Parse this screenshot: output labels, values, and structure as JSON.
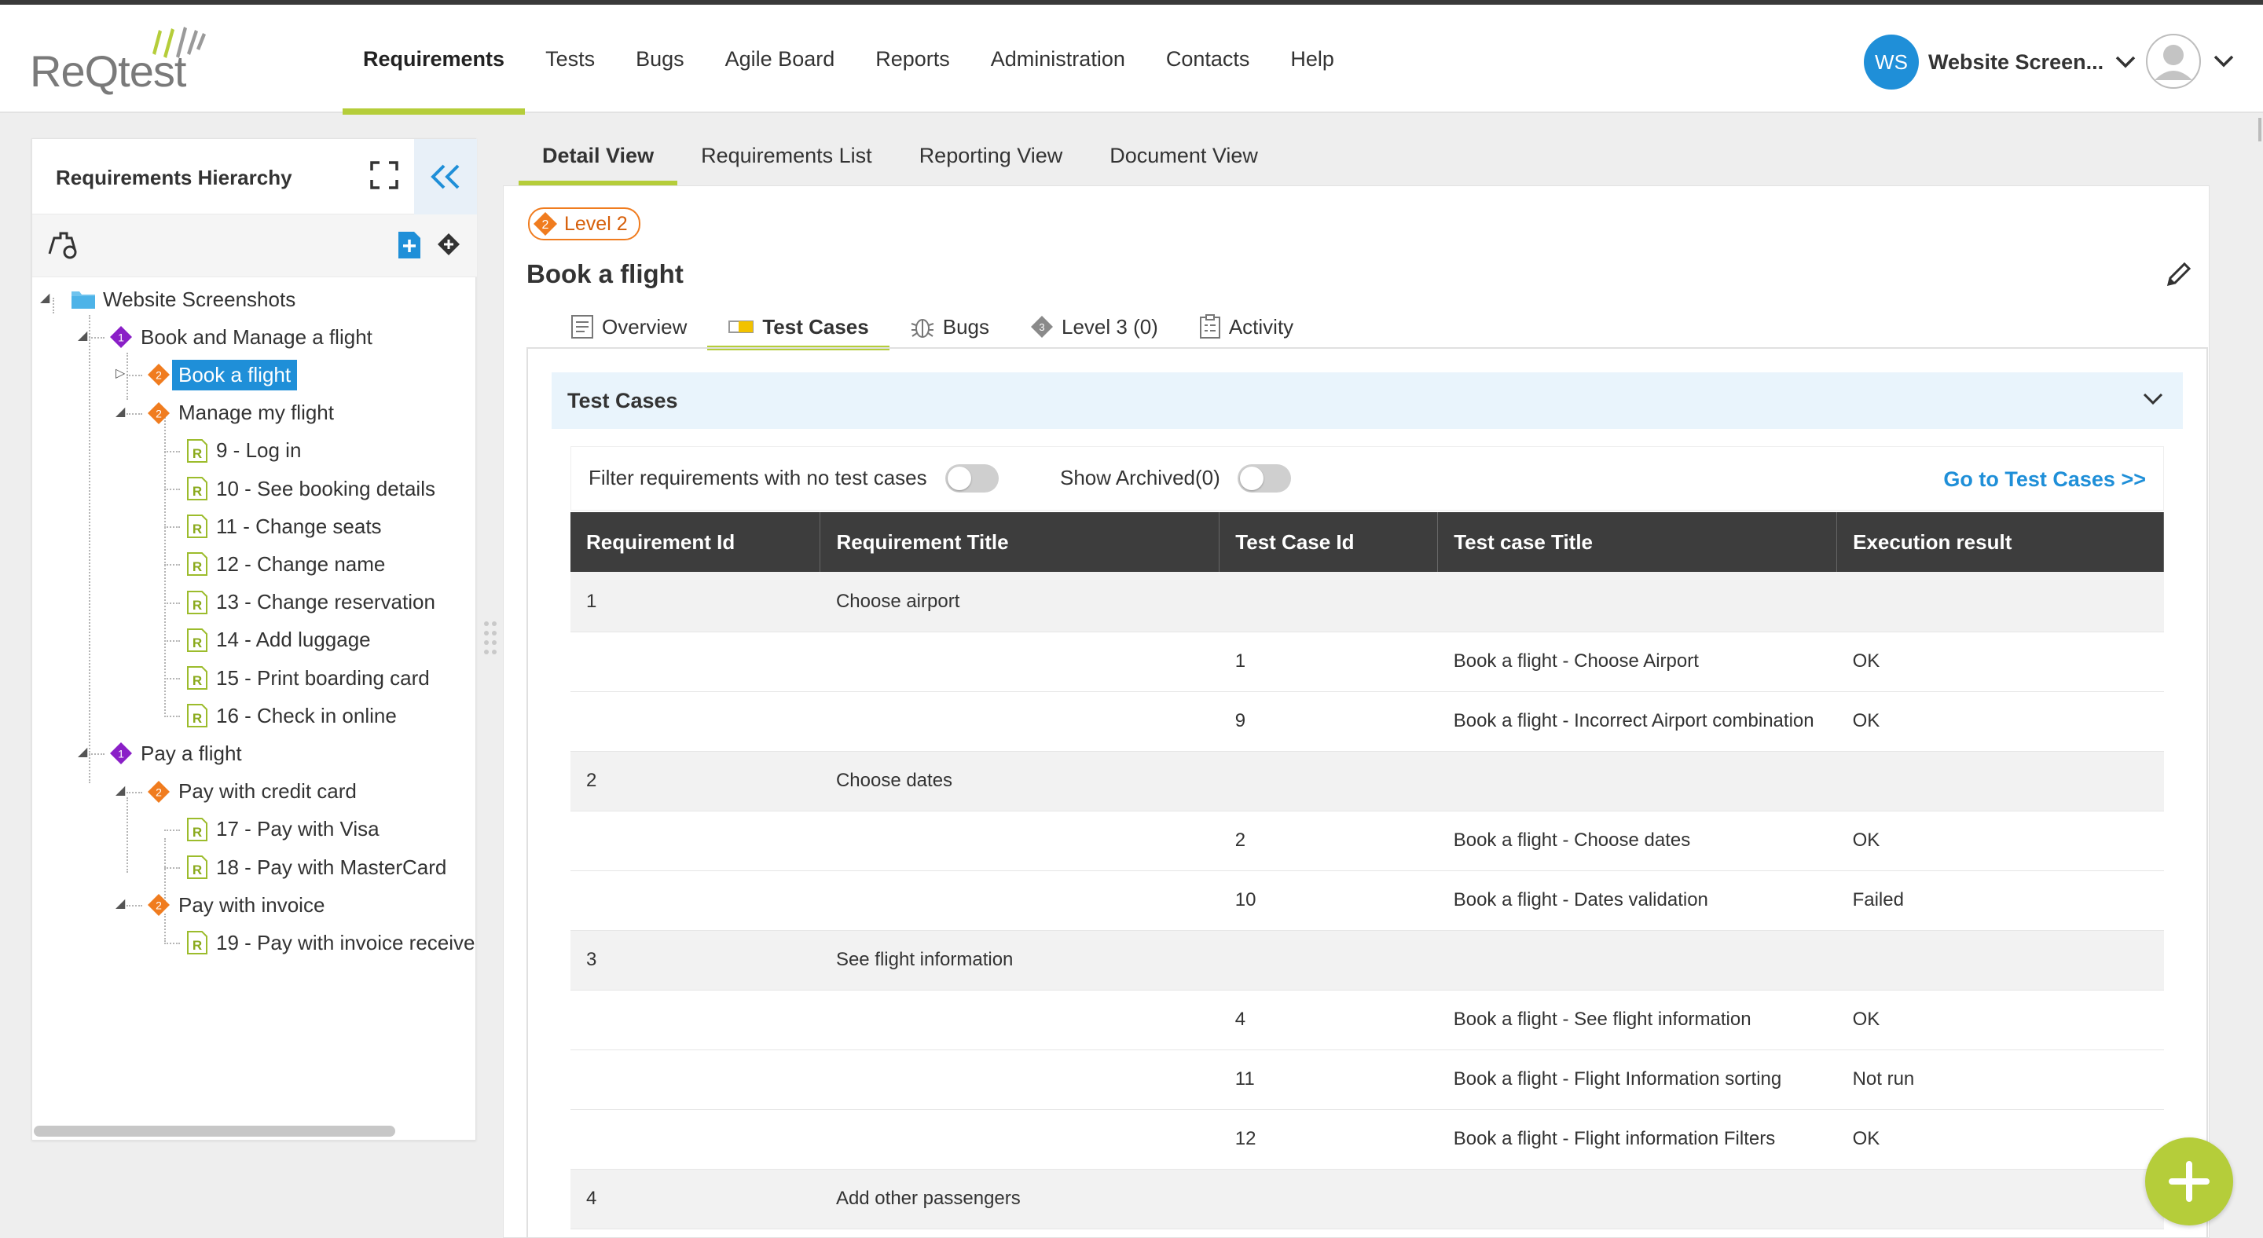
{
  "app": {
    "logo_text": "ReQtest",
    "nav": [
      "Requirements",
      "Tests",
      "Bugs",
      "Agile Board",
      "Reports",
      "Administration",
      "Contacts",
      "Help"
    ],
    "nav_active": 0,
    "account_initials": "WS",
    "account_name": "Website Screen...",
    "colors": {
      "accent": "#b5cd3a",
      "primary": "#1f8fd8",
      "level1": "#8a1fc7",
      "level2": "#f07c1f"
    }
  },
  "hierarchy": {
    "title": "Requirements Hierarchy",
    "tree": [
      {
        "label": "Website Screenshots",
        "type": "folder"
      },
      {
        "label": "Book and Manage a flight",
        "type": "level",
        "badge": "1"
      },
      {
        "label": "Book a flight",
        "type": "level",
        "badge": "2",
        "selected": true
      },
      {
        "label": "Manage my flight",
        "type": "level",
        "badge": "2"
      },
      {
        "label": "9 - Log in",
        "type": "req"
      },
      {
        "label": "10 - See booking details",
        "type": "req"
      },
      {
        "label": "11 - Change seats",
        "type": "req"
      },
      {
        "label": "12 - Change name",
        "type": "req"
      },
      {
        "label": "13 - Change reservation",
        "type": "req"
      },
      {
        "label": "14 - Add luggage",
        "type": "req"
      },
      {
        "label": "15 - Print boarding card",
        "type": "req"
      },
      {
        "label": "16 - Check in online",
        "type": "req"
      },
      {
        "label": "Pay a flight",
        "type": "level",
        "badge": "1"
      },
      {
        "label": "Pay with credit card",
        "type": "level",
        "badge": "2"
      },
      {
        "label": "17 - Pay with Visa",
        "type": "req"
      },
      {
        "label": "18 - Pay with MasterCard",
        "type": "req"
      },
      {
        "label": "Pay with invoice",
        "type": "level",
        "badge": "2"
      },
      {
        "label": "19 - Pay with invoice receive",
        "type": "req"
      }
    ],
    "req_icon_letter": "R"
  },
  "main": {
    "tabs": [
      "Detail View",
      "Requirements List",
      "Reporting View",
      "Document View"
    ],
    "level_badge": "Level 2",
    "level_badge_num": "2",
    "title": "Book a flight",
    "sub_tabs": [
      "Overview",
      "Test Cases",
      "Bugs",
      "Level 3 (0)",
      "Activity"
    ],
    "section_title": "Test Cases",
    "filter_label": "Filter requirements with no test cases",
    "archived_label": "Show Archived(0)",
    "goto_link": "Go to Test Cases >>",
    "columns": [
      "Requirement Id",
      "Requirement  Title",
      "Test Case Id",
      "Test case Title",
      "Execution result"
    ],
    "rows": [
      {
        "kind": "req",
        "cells": [
          "1",
          "Choose airport",
          "",
          "",
          ""
        ]
      },
      {
        "kind": "tc",
        "cells": [
          "",
          "",
          "1",
          "Book a flight - Choose Airport",
          "OK"
        ]
      },
      {
        "kind": "tc",
        "cells": [
          "",
          "",
          "9",
          "Book a flight - Incorrect Airport combination",
          "OK"
        ]
      },
      {
        "kind": "req",
        "cells": [
          "2",
          "Choose dates",
          "",
          "",
          ""
        ]
      },
      {
        "kind": "tc",
        "cells": [
          "",
          "",
          "2",
          "Book a flight - Choose dates",
          "OK"
        ]
      },
      {
        "kind": "tc",
        "cells": [
          "",
          "",
          "10",
          "Book a flight - Dates validation",
          "Failed"
        ]
      },
      {
        "kind": "req",
        "cells": [
          "3",
          "See flight information",
          "",
          "",
          ""
        ]
      },
      {
        "kind": "tc",
        "cells": [
          "",
          "",
          "4",
          "Book a flight - See flight information",
          "OK"
        ]
      },
      {
        "kind": "tc",
        "cells": [
          "",
          "",
          "11",
          "Book a flight - Flight Information sorting",
          "Not run"
        ]
      },
      {
        "kind": "tc",
        "cells": [
          "",
          "",
          "12",
          "Book a flight - Flight information Filters",
          "OK"
        ]
      },
      {
        "kind": "req",
        "cells": [
          "4",
          "Add other passengers",
          "",
          "",
          ""
        ]
      }
    ]
  }
}
